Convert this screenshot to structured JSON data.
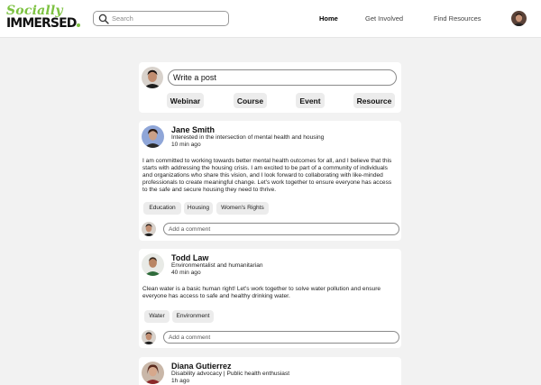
{
  "logo": {
    "top": "Socially",
    "bottom": "IMMERSED"
  },
  "search": {
    "placeholder": "Search"
  },
  "nav": {
    "home": "Home",
    "get_involved": "Get Involved",
    "find_resources": "Find Resources"
  },
  "composer": {
    "placeholder": "Write a post",
    "buttons": [
      "Webinar",
      "Course",
      "Event",
      "Resource"
    ]
  },
  "comment_placeholder": "Add a comment",
  "posts": [
    {
      "name": "Jane Smith",
      "bio": "Interested in the intersection of mental health and housing",
      "time": "10 min ago",
      "body": "I am committed to working towards better mental health outcomes for all, and I believe that this starts with addressing the housing crisis. I am excited to be part of a community of individuals and organizations who share this vision, and I look forward to collaborating with like-minded professionals to create meaningful change. Let's work together to ensure everyone has access to the safe and secure housing they need to thrive.",
      "tags": [
        "Education",
        "Housing",
        "Women's Rights"
      ]
    },
    {
      "name": "Todd Law",
      "bio": "Environmentalist and humanitarian",
      "time": "40 min ago",
      "body": "Clean water is a basic human right! Let's work together to solve water pollution and ensure everyone has access to safe and healthy drinking water.",
      "tags": [
        "Water",
        "Environment"
      ]
    },
    {
      "name": "Diana Gutierrez",
      "bio": "Disability advocacy | Public health enthusiast",
      "time": "1h ago"
    }
  ],
  "colors": {
    "brand_green": "#7dc242",
    "background": "#f2f2f2",
    "chip": "#ececec"
  },
  "icons": {
    "search": "search-icon"
  }
}
